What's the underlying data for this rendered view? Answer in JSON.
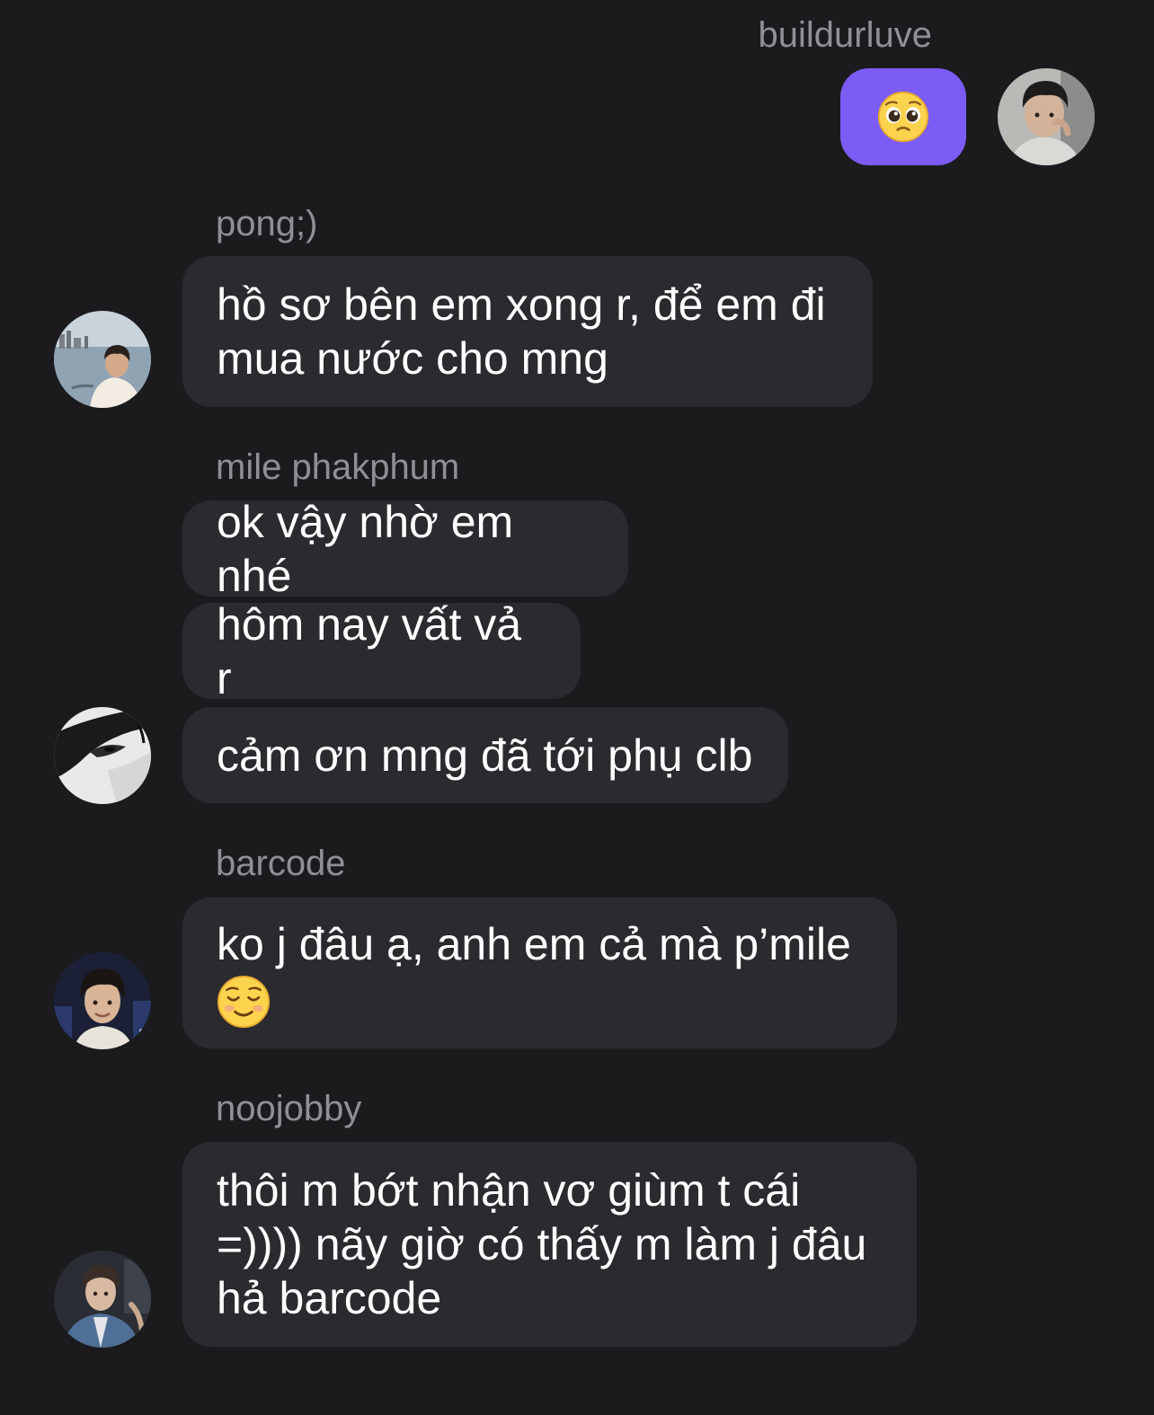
{
  "messages": [
    {
      "sender": "buildurluve",
      "own": true,
      "bubbles": [
        {
          "emoji": "pleading-face"
        }
      ]
    },
    {
      "sender": "pong;)",
      "bubbles": [
        {
          "text": "hồ sơ bên em xong r, để em đi\nmua nước cho mng"
        }
      ]
    },
    {
      "sender": "mile phakphum",
      "bubbles": [
        {
          "text": "ok vậy nhờ em nhé"
        },
        {
          "text": "hôm nay vất vả r"
        },
        {
          "text": "cảm ơn mng đã tới phụ clb"
        }
      ]
    },
    {
      "sender": "barcode",
      "bubbles": [
        {
          "text": "ko j đâu ạ, anh em cả mà p’mile",
          "emoji": "smiling-face"
        }
      ]
    },
    {
      "sender": "noojobby",
      "bubbles": [
        {
          "text": "thôi m bớt nhận vơ giùm t cái\n=)))) nãy giờ có thấy m làm j đâu\nhả barcode"
        }
      ]
    }
  ],
  "colors": {
    "background": "#1b1b1e",
    "incoming_bubble": "#2b2b2f",
    "outgoing_bubble": "#7b5cf5",
    "sender_name": "#8f8f95",
    "message_text": "#ffffff"
  }
}
